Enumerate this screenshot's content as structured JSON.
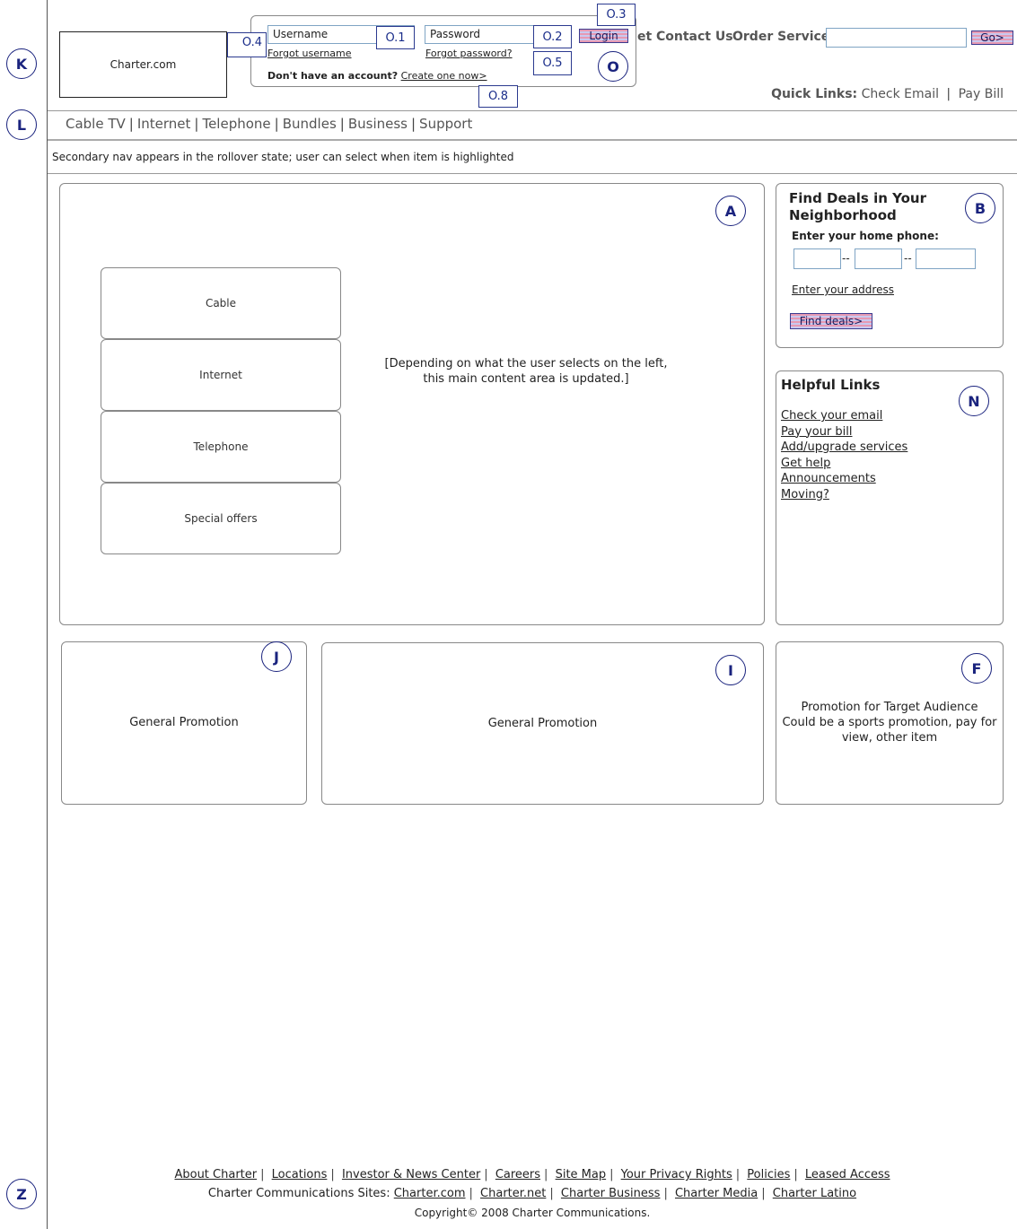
{
  "annotations": {
    "k": "K",
    "l": "L",
    "z": "Z",
    "a": "A",
    "b": "B",
    "n": "N",
    "j": "J",
    "i": "I",
    "f": "F",
    "o": "O",
    "o1": "O.1",
    "o2": "O.2",
    "o3": "O.3",
    "o4": "O.4",
    "o5": "O.5",
    "o8": "O.8"
  },
  "header": {
    "logo_text": "Charter.com",
    "username_placeholder": "Username",
    "password_placeholder": "Password",
    "login_label": "Login",
    "forgot_username": "Forgot username",
    "forgot_password": "Forgot password?",
    "no_account": "Don't have an account?",
    "create_one": "Create one now>",
    "top_link_partial": "et",
    "contact_us": "Contact Us",
    "order_services": "Order Services",
    "go_label": "Go>",
    "quick_links_label": "Quick Links:",
    "quick_links": [
      "Check Email",
      "Pay Bill"
    ]
  },
  "nav": {
    "items": [
      "Cable TV",
      "Internet",
      "Telephone",
      "Bundles",
      "Business",
      "Support"
    ],
    "secondary_note": "Secondary nav appears in the rollover state; user can select when item is highlighted"
  },
  "main": {
    "left_buttons": [
      "Cable",
      "Internet",
      "Telephone",
      "Special offers"
    ],
    "content_note_line1": "[Depending on what the user selects on the left,",
    "content_note_line2": "this main content area is updated.]"
  },
  "deals": {
    "title_line1": "Find Deals in Your",
    "title_line2": "Neighborhood",
    "phone_label": "Enter your home phone:",
    "dash": "--",
    "address_link": "Enter your address",
    "find_button": "Find deals>"
  },
  "helpful": {
    "title": "Helpful Links",
    "links": [
      "Check your email",
      "Pay your bill",
      "Add/upgrade services",
      "Get help",
      "Announcements",
      "Moving?"
    ]
  },
  "promos": {
    "j_text": "General Promotion",
    "i_text": "General Promotion",
    "f_line1": "Promotion for Target Audience",
    "f_line2": "Could be a sports promotion, pay for",
    "f_line3": "view, other item"
  },
  "footer": {
    "row1": [
      "About Charter",
      "Locations",
      "Investor & News Center",
      "Careers",
      "Site Map",
      "Your Privacy Rights",
      "Policies",
      "Leased Access"
    ],
    "sites_label": "Charter Communications Sites:",
    "row2": [
      "Charter.com",
      "Charter.net",
      "Charter Business",
      "Charter Media",
      "Charter Latino"
    ],
    "copyright": "Copyright© 2008 Charter Communications."
  }
}
